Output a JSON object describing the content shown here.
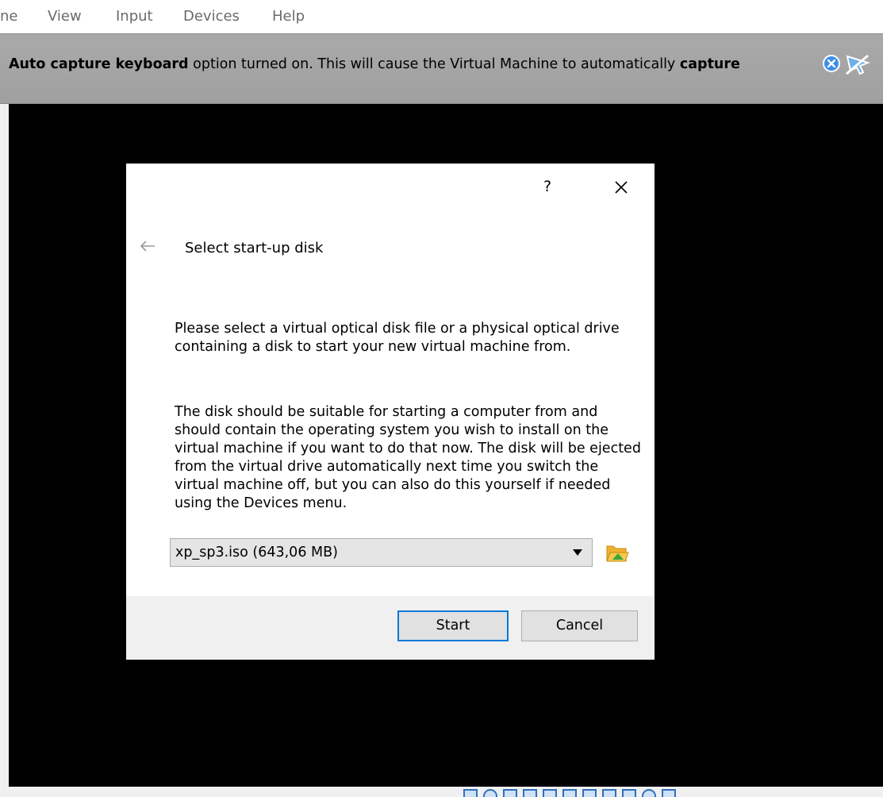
{
  "menu": {
    "items": [
      "ne",
      "View",
      "Input",
      "Devices",
      "Help"
    ]
  },
  "notification": {
    "bold_1": "Auto capture keyboard",
    "text_1": " option turned on. This will cause the Virtual Machine to automatically ",
    "bold_2": "capture",
    "close_icon": "close-icon",
    "pin_icon": "mouse-pointer-icon"
  },
  "dialog": {
    "help_label": "?",
    "title": "Select start-up disk",
    "paragraph_1": "Please select a virtual optical disk file or a physical optical drive containing a disk to start your new virtual machine from.",
    "paragraph_2": "The disk should be suitable for starting a computer from and should contain the operating system you wish to install on the virtual machine if you want to do that now. The disk will be ejected from the virtual drive automatically next time you switch the virtual machine off, but you can also do this yourself if needed using the Devices menu.",
    "disk_select_value": "xp_sp3.iso (643,06 MB)",
    "start_label": "Start",
    "cancel_label": "Cancel"
  },
  "colors": {
    "accent": "#0078d7",
    "notice_bg": "#a5a5a5",
    "vm_bg": "#000000"
  }
}
